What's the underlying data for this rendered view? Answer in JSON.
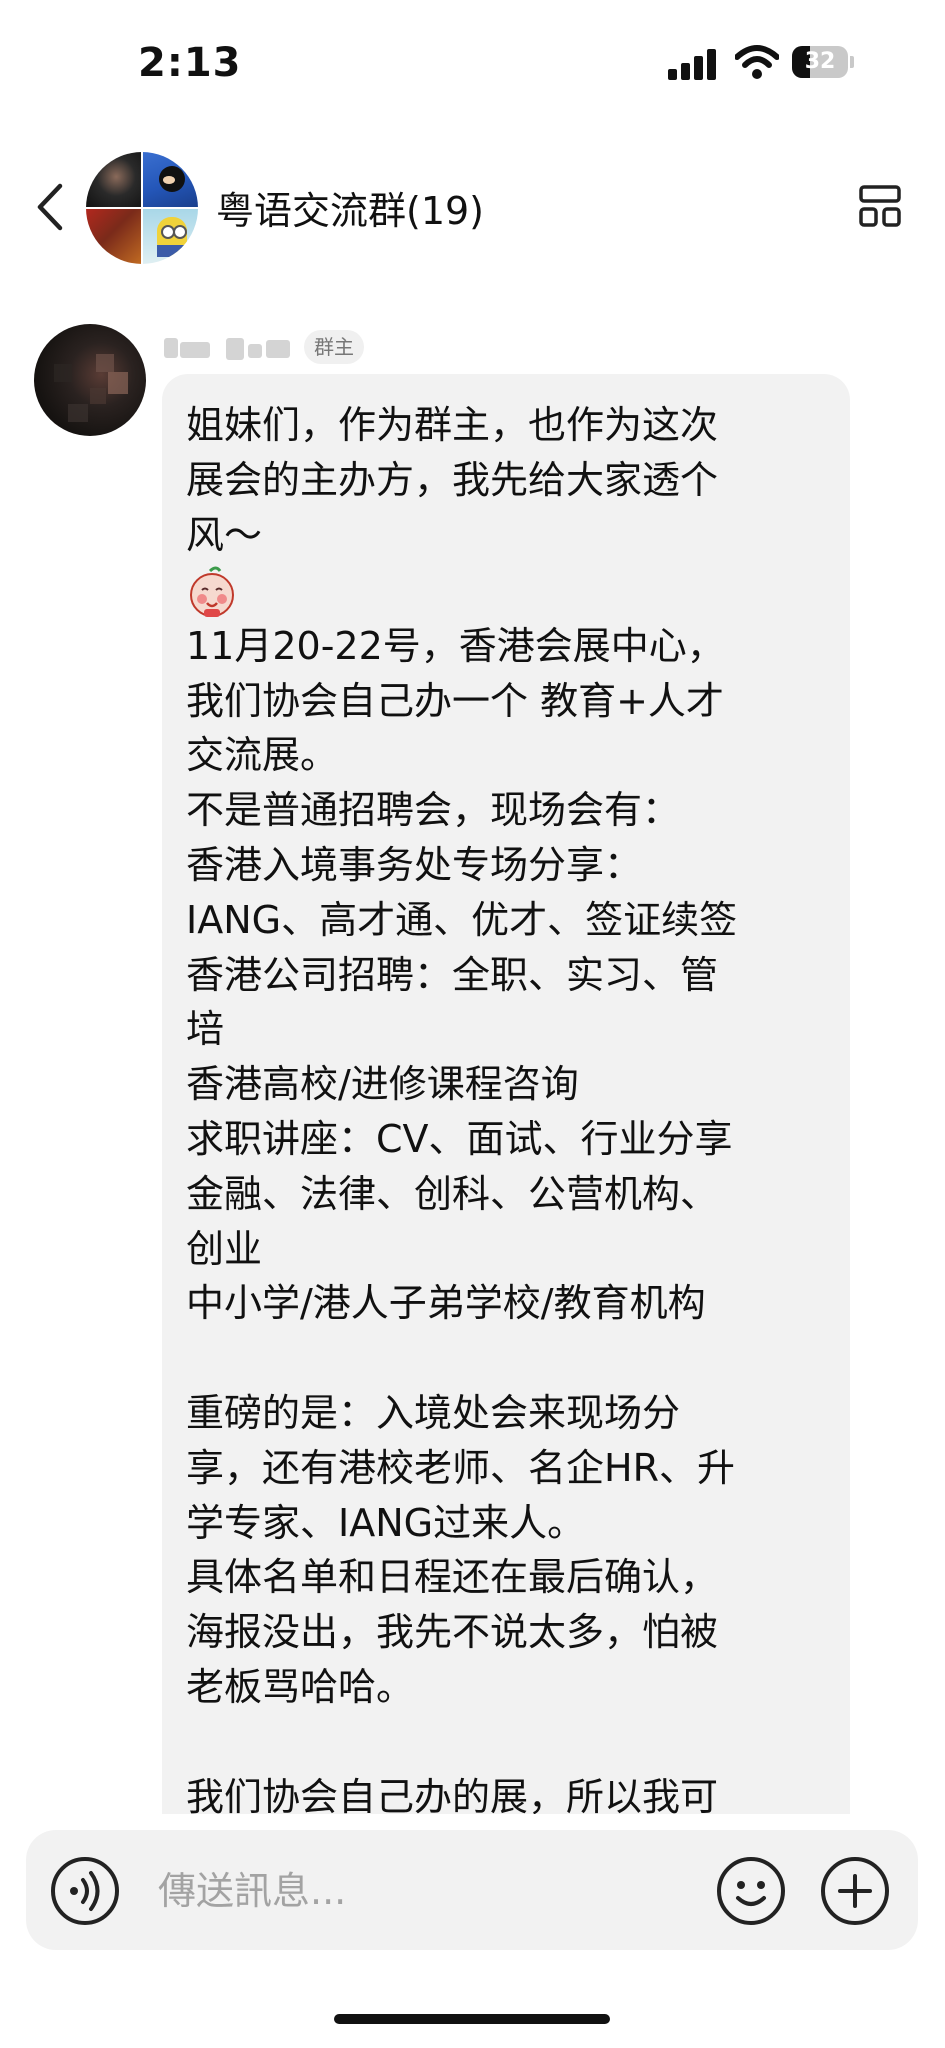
{
  "status_bar": {
    "time": "2:13",
    "battery_level": "32",
    "battery_fraction": 0.32
  },
  "header": {
    "group_name": "粤语交流群(19)",
    "back_icon": "chevron-left-icon",
    "info_icon": "group-info-icon"
  },
  "message": {
    "sender_role": "群主",
    "lines_part1": "姐妹们，作为群主，也作为这次\n展会的主办方，我先给大家透个\n风～",
    "emoji": "smiling-face-sticker",
    "lines_part2": "11月20-22号，香港会展中心，\n我们协会自己办一个 教育+人才\n交流展。\n不是普通招聘会，现场会有：\n香港入境事务处专场分享：\nIANG、高才通、优才、签证续签\n香港公司招聘：全职、实习、管\n培\n香港高校/进修课程咨询\n求职讲座：CV、面试、行业分享\n金融、法律、创科、公营机构、\n创业\n中小学/港人子弟学校/教育机构\n\n重磅的是：入境处会来现场分\n享，还有港校老师、名企HR、升\n学专家、IANG过来人。\n具体名单和日程还在最后确认，\n海报没出，我先不说太多，怕被\n老板骂哈哈。\n\n我们协会自己办的展，所以我可"
  },
  "composer": {
    "placeholder": "傳送訊息...",
    "voice_icon": "voice-icon",
    "emoji_icon": "emoji-icon",
    "add_icon": "plus-icon"
  }
}
